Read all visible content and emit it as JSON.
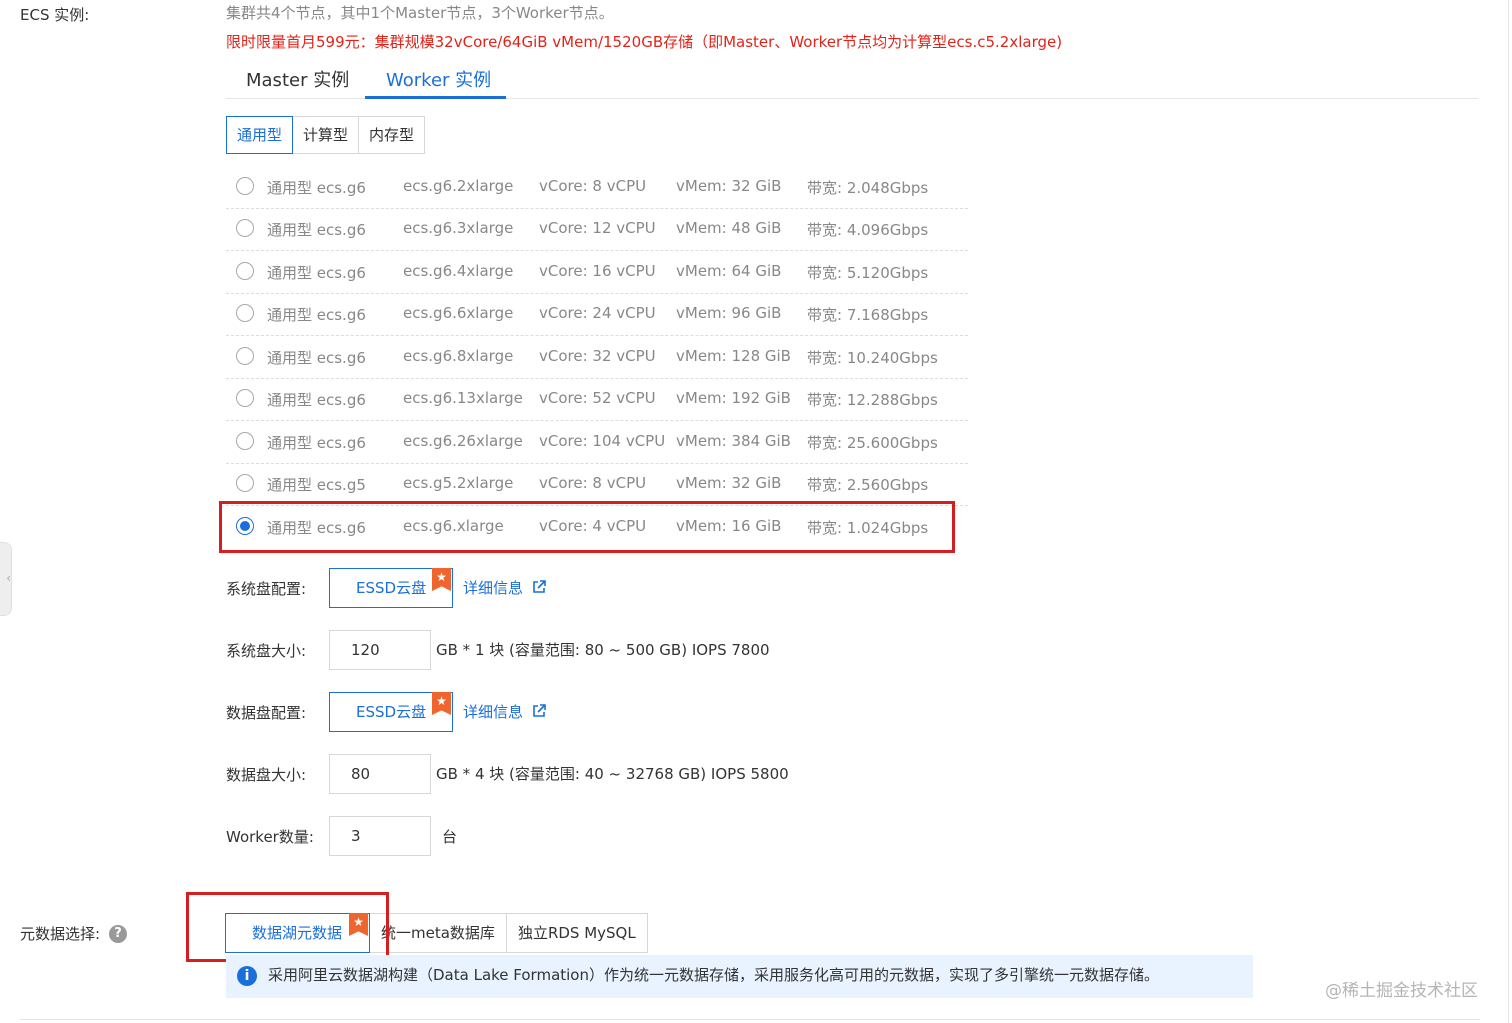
{
  "ecs": {
    "label": "ECS 实例:",
    "note": "集群共4个节点，其中1个Master节点，3个Worker节点。",
    "promo": "限时限量首月599元：集群规模32vCore/64GiB vMem/1520GB存储（即Master、Worker节点均为计算型ecs.c5.2xlarge)"
  },
  "tabs": [
    {
      "label": "Master 实例",
      "active": false
    },
    {
      "label": "Worker 实例",
      "active": true
    }
  ],
  "family_filter": [
    {
      "label": "通用型",
      "active": true
    },
    {
      "label": "计算型",
      "active": false
    },
    {
      "label": "内存型",
      "active": false
    }
  ],
  "instances": [
    {
      "family": "通用型 ecs.g6",
      "type": "ecs.g6.2xlarge",
      "vcore": "vCore: 8 vCPU",
      "vmem": "vMem: 32 GiB",
      "bandwidth": "带宽: 2.048Gbps",
      "selected": false
    },
    {
      "family": "通用型 ecs.g6",
      "type": "ecs.g6.3xlarge",
      "vcore": "vCore: 12 vCPU",
      "vmem": "vMem: 48 GiB",
      "bandwidth": "带宽: 4.096Gbps",
      "selected": false
    },
    {
      "family": "通用型 ecs.g6",
      "type": "ecs.g6.4xlarge",
      "vcore": "vCore: 16 vCPU",
      "vmem": "vMem: 64 GiB",
      "bandwidth": "带宽: 5.120Gbps",
      "selected": false
    },
    {
      "family": "通用型 ecs.g6",
      "type": "ecs.g6.6xlarge",
      "vcore": "vCore: 24 vCPU",
      "vmem": "vMem: 96 GiB",
      "bandwidth": "带宽: 7.168Gbps",
      "selected": false
    },
    {
      "family": "通用型 ecs.g6",
      "type": "ecs.g6.8xlarge",
      "vcore": "vCore: 32 vCPU",
      "vmem": "vMem: 128 GiB",
      "bandwidth": "带宽: 10.240Gbps",
      "selected": false
    },
    {
      "family": "通用型 ecs.g6",
      "type": "ecs.g6.13xlarge",
      "vcore": "vCore: 52 vCPU",
      "vmem": "vMem: 192 GiB",
      "bandwidth": "带宽: 12.288Gbps",
      "selected": false
    },
    {
      "family": "通用型 ecs.g6",
      "type": "ecs.g6.26xlarge",
      "vcore": "vCore: 104 vCPU",
      "vmem": "vMem: 384 GiB",
      "bandwidth": "带宽: 25.600Gbps",
      "selected": false
    },
    {
      "family": "通用型 ecs.g5",
      "type": "ecs.g5.2xlarge",
      "vcore": "vCore: 8 vCPU",
      "vmem": "vMem: 32 GiB",
      "bandwidth": "带宽: 2.560Gbps",
      "selected": false
    },
    {
      "family": "通用型 ecs.g6",
      "type": "ecs.g6.xlarge",
      "vcore": "vCore: 4 vCPU",
      "vmem": "vMem: 16 GiB",
      "bandwidth": "带宽: 1.024Gbps",
      "selected": true
    }
  ],
  "system_disk": {
    "config_label": "系统盘配置:",
    "type": "ESSD云盘",
    "detail_link": "详细信息",
    "size_label": "系统盘大小:",
    "size_value": "120",
    "size_suffix": "GB * 1 块 (容量范围: 80 ~ 500 GB)  IOPS 7800"
  },
  "data_disk": {
    "config_label": "数据盘配置:",
    "type": "ESSD云盘",
    "detail_link": "详细信息",
    "size_label": "数据盘大小:",
    "size_value": "80",
    "size_suffix": "GB * 4 块 (容量范围: 40 ~ 32768 GB)  IOPS 5800"
  },
  "worker_count": {
    "label": "Worker数量:",
    "value": "3",
    "unit": "台"
  },
  "metadata": {
    "label": "元数据选择:",
    "options": [
      {
        "label": "数据湖元数据",
        "active": true
      },
      {
        "label": "统一meta数据库",
        "active": false
      },
      {
        "label": "独立RDS MySQL",
        "active": false
      }
    ],
    "info": "采用阿里云数据湖构建（Data Lake Formation）作为统一元数据存储，采用服务化高可用的元数据，实现了多引擎统一元数据存储。"
  },
  "watermark": "@稀土掘金技术社区",
  "colors": {
    "accent": "#1b6fd8",
    "promo_red": "#e2231a",
    "highlight_box": "#d31f1f",
    "badge_orange": "#f0642d",
    "info_bg": "#e8f3ff"
  }
}
